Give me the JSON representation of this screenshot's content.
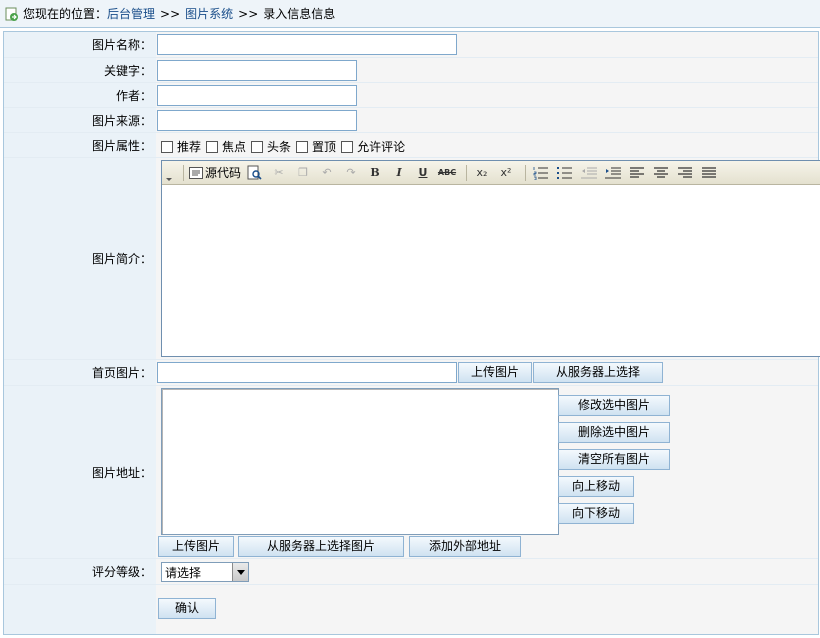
{
  "breadcrumb": {
    "prefix": "您现在的位置：",
    "links": [
      "后台管理",
      "图片系统"
    ],
    "separator": ">>",
    "current": "录入信息信息"
  },
  "form": {
    "name_label": "图片名称：",
    "keyword_label": "关键字：",
    "author_label": "作者：",
    "source_label": "图片来源：",
    "attr_label": "图片属性：",
    "attrs": [
      "推荐",
      "焦点",
      "头条",
      "置顶",
      "允许评论"
    ],
    "intro_label": "图片简介：",
    "editor_source_label": "源代码",
    "cover_label": "首页图片：",
    "cover_upload_button": "上传图片",
    "cover_server_button": "从服务器上选择",
    "address_label": "图片地址：",
    "address_buttons": [
      "修改选中图片",
      "删除选中图片",
      "清空所有图片",
      "向上移动",
      "向下移动"
    ],
    "upload_button": "上传图片",
    "server_select_button": "从服务器上选择图片",
    "external_button": "添加外部地址",
    "rating_label": "评分等级：",
    "rating_selected": "请选择",
    "confirm_button": "确认"
  },
  "colors": {
    "label_bg": "#eaf2f8",
    "value_bg": "#f5f5f5",
    "link": "#1a4e8a",
    "border": "#a9c7dd"
  }
}
